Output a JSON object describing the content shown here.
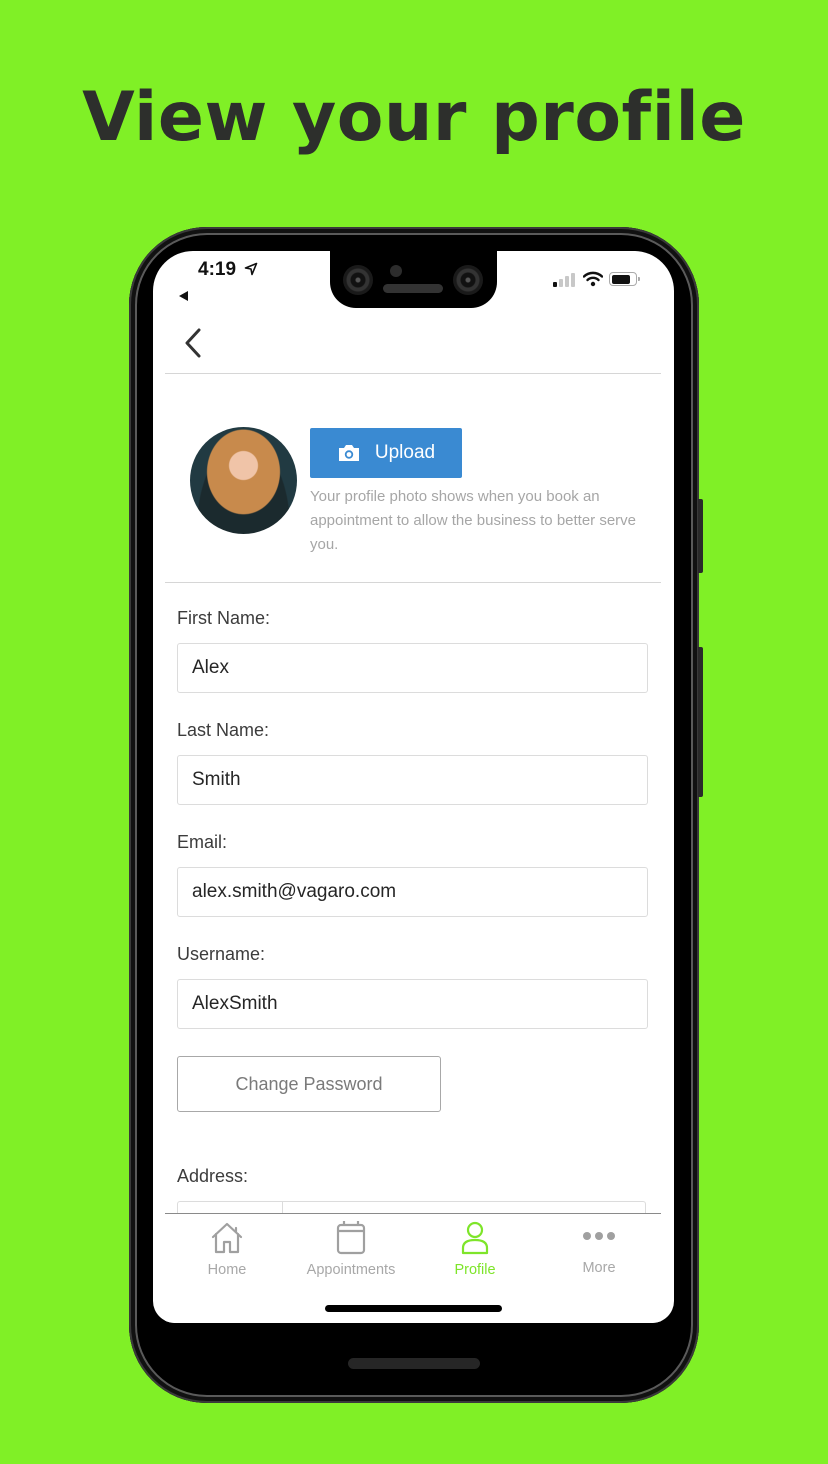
{
  "headline": "View your profile",
  "status_bar": {
    "time": "4:19",
    "back_app_indicator": "◀",
    "signal_bars_active": 1,
    "signal_bars_total": 4,
    "battery_level_percent": 80
  },
  "nav": {
    "back_icon": "chevron-left-icon"
  },
  "profile_photo": {
    "avatar_alt": "Profile photo of Alex Smith",
    "upload_label": "Upload",
    "upload_icon": "camera-icon",
    "note": "Your profile photo shows when you book an appointment to allow the business to better serve you."
  },
  "form": {
    "first_name": {
      "label": "First Name:",
      "value": "Alex"
    },
    "last_name": {
      "label": "Last Name:",
      "value": "Smith"
    },
    "email": {
      "label": "Email:",
      "value": "alex.smith@vagaro.com"
    },
    "username": {
      "label": "Username:",
      "value": "AlexSmith"
    },
    "change_password_label": "Change Password",
    "address": {
      "label": "Address:"
    }
  },
  "tab_bar": {
    "active_color": "#7ee52a",
    "inactive_color": "#a8a8a8",
    "items": [
      {
        "label": "Home",
        "icon": "home-icon",
        "active": false
      },
      {
        "label": "Appointments",
        "icon": "calendar-icon",
        "active": false
      },
      {
        "label": "Profile",
        "icon": "person-icon",
        "active": true
      },
      {
        "label": "More",
        "icon": "more-dots-icon",
        "active": false
      }
    ]
  },
  "colors": {
    "background": "#80f026",
    "upload_button": "#3a8ad2",
    "headline_text": "#2d2f2c"
  }
}
